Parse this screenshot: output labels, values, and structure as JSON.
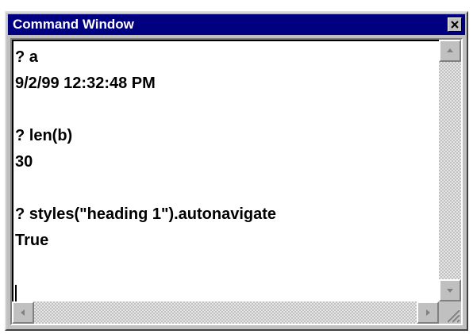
{
  "window": {
    "title": "Command Window",
    "close_label": "close"
  },
  "console": {
    "lines": [
      "? a",
      "9/2/99 12:32:48 PM",
      "",
      "? len(b)",
      "30",
      "",
      "? styles(\"heading 1\").autonavigate",
      "True",
      ""
    ]
  },
  "icons": {
    "close": "close-icon",
    "scroll_up": "arrow-up-icon",
    "scroll_down": "arrow-down-icon",
    "scroll_left": "arrow-left-icon",
    "scroll_right": "arrow-right-icon",
    "resize": "resize-grip-icon"
  },
  "colors": {
    "title_bar": "#000080",
    "title_text": "#ffffff",
    "face": "#c0c0c0",
    "text_bg": "#ffffff"
  }
}
